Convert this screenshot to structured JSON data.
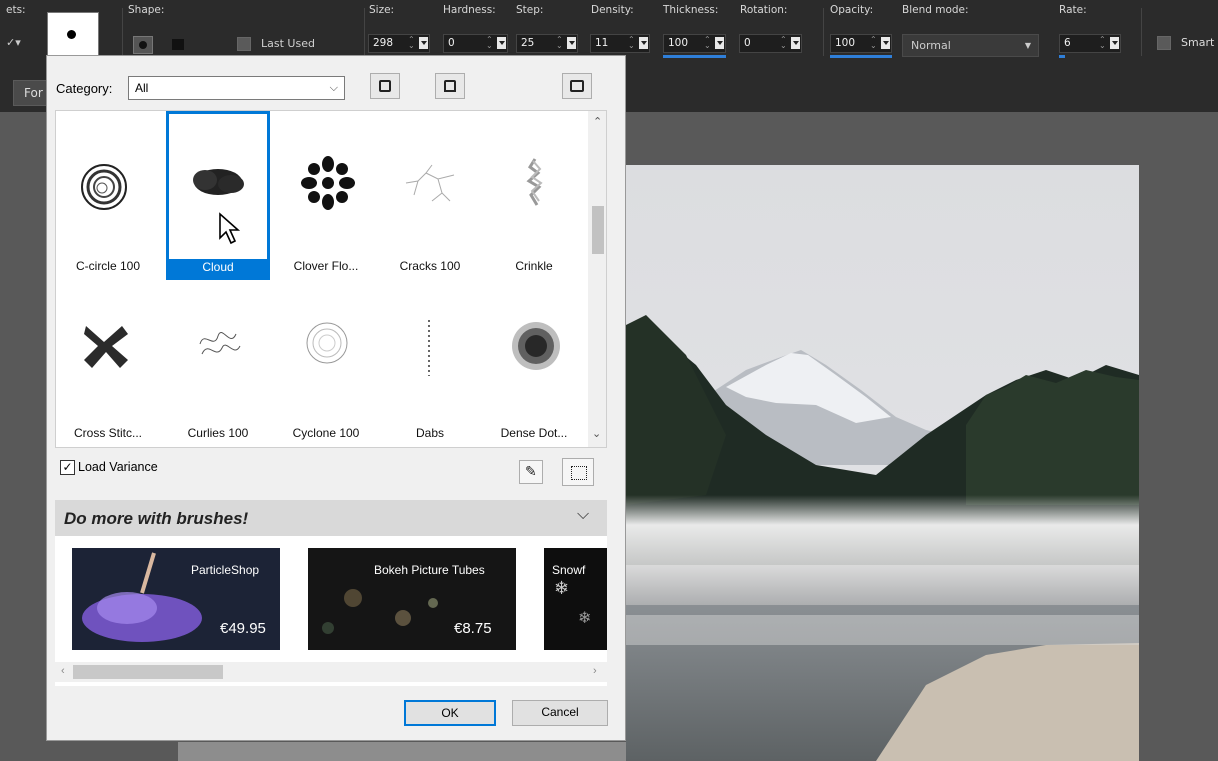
{
  "toolbar": {
    "presets_label": "ets:",
    "shape_label": "Shape:",
    "last_used_label": "Last Used",
    "size": {
      "label": "Size:",
      "value": "298"
    },
    "hardness": {
      "label": "Hardness:",
      "value": "0"
    },
    "step": {
      "label": "Step:",
      "value": "25"
    },
    "density": {
      "label": "Density:",
      "value": "11"
    },
    "thickness": {
      "label": "Thickness:",
      "value": "100"
    },
    "rotation": {
      "label": "Rotation:",
      "value": "0"
    },
    "opacity": {
      "label": "Opacity:",
      "value": "100"
    },
    "blend_mode": {
      "label": "Blend mode:",
      "value": "Normal"
    },
    "rate": {
      "label": "Rate:",
      "value": "6"
    },
    "smart_label": "Smart",
    "tab_label": "For"
  },
  "dialog": {
    "category_label": "Category:",
    "category_value": "All",
    "brushes": [
      {
        "label": "C-circle 100",
        "icon": "c-circle-brush-icon"
      },
      {
        "label": "Cloud",
        "icon": "cloud-brush-icon",
        "selected": true
      },
      {
        "label": "Clover Flo...",
        "icon": "clover-brush-icon"
      },
      {
        "label": "Cracks 100",
        "icon": "cracks-brush-icon"
      },
      {
        "label": "Crinkle",
        "icon": "crinkle-brush-icon"
      },
      {
        "label": "Cross Stitc...",
        "icon": "cross-stitch-brush-icon"
      },
      {
        "label": "Curlies 100",
        "icon": "curlies-brush-icon"
      },
      {
        "label": "Cyclone 100",
        "icon": "cyclone-brush-icon"
      },
      {
        "label": "Dabs",
        "icon": "dabs-brush-icon"
      },
      {
        "label": "Dense Dot...",
        "icon": "dense-dots-brush-icon"
      }
    ],
    "load_variance_label": "Load Variance",
    "load_variance_checked": true,
    "promo_title": "Do more with brushes!",
    "promos": [
      {
        "name": "ParticleShop",
        "price": "€49.95"
      },
      {
        "name": "Bokeh Picture Tubes",
        "price": "€8.75"
      },
      {
        "name": "Snowf",
        "price": ""
      }
    ],
    "ok_label": "OK",
    "cancel_label": "Cancel"
  },
  "colors": {
    "accent": "#0078d7",
    "selection": "#0078d7"
  }
}
